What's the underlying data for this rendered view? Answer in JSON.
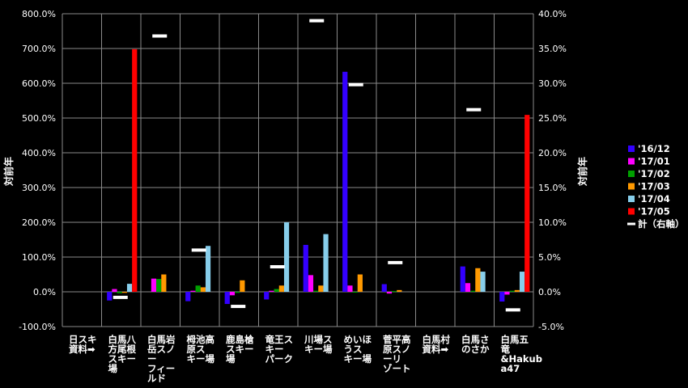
{
  "chart_data": {
    "type": "bar",
    "ylabel": "対前年",
    "y2label": "対前年",
    "ylim": [
      -100,
      800
    ],
    "y2lim": [
      -5,
      40
    ],
    "yticks": [
      "-100.0%",
      "0.0%",
      "100.0%",
      "200.0%",
      "300.0%",
      "400.0%",
      "500.0%",
      "600.0%",
      "700.0%",
      "800.0%"
    ],
    "y2ticks": [
      "-5.0%",
      "0.0%",
      "5.0%",
      "10.0%",
      "15.0%",
      "20.0%",
      "25.0%",
      "30.0%",
      "35.0%",
      "40.0%"
    ],
    "grid": true,
    "legend_position": "right",
    "categories": [
      [
        "日スキ",
        "資料➡"
      ],
      [
        "白馬八",
        "方尾根",
        "スキー",
        "場"
      ],
      [
        "白馬岩",
        "岳スノ",
        "ー",
        "フィー",
        "ルド"
      ],
      [
        "栂池高",
        "原ス",
        "キー場"
      ],
      [
        "鹿島槍",
        "スキー",
        "場"
      ],
      [
        "竜王ス",
        "キー",
        "パーク"
      ],
      [
        "川場ス",
        "キー場"
      ],
      [
        "めいほ",
        "うス",
        "キー場"
      ],
      [
        "菅平高",
        "原スノ",
        "ーリ",
        "ゾート"
      ],
      [
        "白馬村",
        "資料➡"
      ],
      [
        "白馬さ",
        "のさか"
      ],
      [
        "白馬五",
        "竜",
        "&Hakub",
        "a47"
      ]
    ],
    "series": [
      {
        "name": "'16/12",
        "color": "#3300ff",
        "values": [
          null,
          -25,
          null,
          -27,
          -35,
          -22,
          135,
          633,
          22,
          null,
          73,
          -28
        ]
      },
      {
        "name": "'17/01",
        "color": "#ff00ff",
        "values": [
          null,
          8,
          38,
          3,
          -10,
          3,
          48,
          18,
          -5,
          null,
          25,
          -8
        ]
      },
      {
        "name": "'17/02",
        "color": "#00a000",
        "values": [
          null,
          -4,
          37,
          18,
          -3,
          8,
          3,
          -2,
          2,
          null,
          3,
          3
        ]
      },
      {
        "name": "'17/03",
        "color": "#ff9900",
        "values": [
          null,
          -3,
          50,
          13,
          33,
          18,
          18,
          50,
          5,
          null,
          68,
          5
        ]
      },
      {
        "name": "'17/04",
        "color": "#87ceeb",
        "values": [
          null,
          23,
          null,
          132,
          null,
          200,
          166,
          null,
          null,
          null,
          58,
          58
        ]
      },
      {
        "name": "'17/05",
        "color": "#ff0000",
        "values": [
          null,
          698,
          null,
          null,
          null,
          null,
          null,
          null,
          null,
          null,
          null,
          509
        ]
      }
    ],
    "total": {
      "name": "計（右軸）",
      "color": "#ffffff",
      "values": [
        null,
        -0.8,
        36.8,
        6.0,
        -2.1,
        3.6,
        39.0,
        29.8,
        4.2,
        null,
        26.2,
        -2.6
      ]
    }
  }
}
